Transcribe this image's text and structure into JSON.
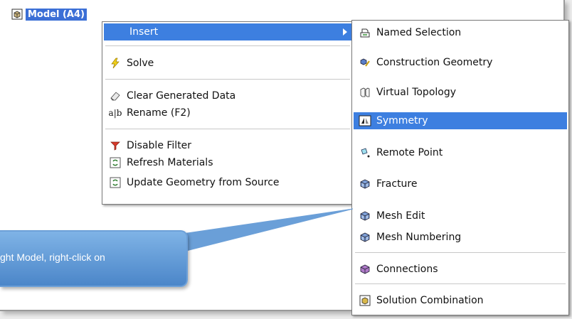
{
  "tree": {
    "node_label": "Model (A4)"
  },
  "main_menu": {
    "insert": "Insert",
    "solve": "Solve",
    "clear_generated_data": "Clear Generated Data",
    "rename": "Rename (F2)",
    "disable_filter": "Disable Filter",
    "refresh_materials": "Refresh Materials",
    "update_geometry": "Update Geometry from Source"
  },
  "sub_menu": {
    "named_selection": "Named Selection",
    "construction_geometry": "Construction Geometry",
    "virtual_topology": "Virtual Topology",
    "symmetry": "Symmetry",
    "remote_point": "Remote Point",
    "fracture": "Fracture",
    "mesh_edit": "Mesh Edit",
    "mesh_numbering": "Mesh Numbering",
    "connections": "Connections",
    "solution_combination": "Solution Combination"
  },
  "callout": {
    "text": "ght Model, right-click on"
  },
  "colors": {
    "highlight": "#3d7fe0",
    "tree_selection": "#3b6fd6",
    "callout": "#5b93d3"
  }
}
